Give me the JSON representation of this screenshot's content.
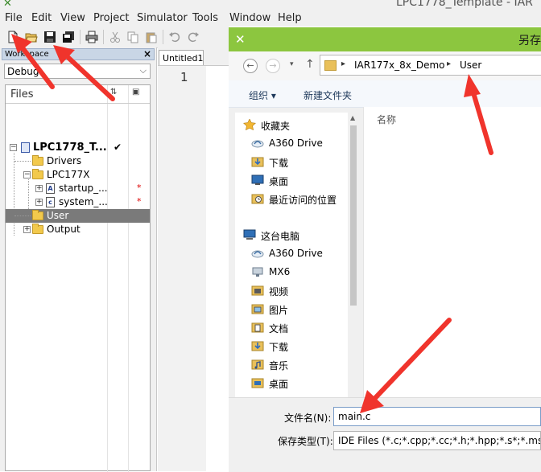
{
  "ide": {
    "title": "LPC1778_Template - IAR",
    "menu": [
      "File",
      "Edit",
      "View",
      "Project",
      "Simulator",
      "Tools",
      "Window",
      "Help"
    ],
    "toolbar_icons": [
      "new-file-icon",
      "open-folder-icon",
      "save-icon",
      "save-all-icon",
      "print-icon",
      "cut-icon",
      "copy-icon",
      "paste-icon",
      "undo-icon",
      "redo-icon"
    ]
  },
  "workspace": {
    "header": "Workspace",
    "close": "×",
    "config": "Debug",
    "files_header": "Files",
    "tree": [
      {
        "label": "LPC1778_T...",
        "check": "✔"
      },
      {
        "label": "Drivers"
      },
      {
        "label": "LPC177X"
      },
      {
        "label": "startup_...",
        "star": "*"
      },
      {
        "label": "system_...",
        "star": "*"
      },
      {
        "label": "User"
      },
      {
        "label": "Output"
      }
    ]
  },
  "editor": {
    "tab": "Untitled1",
    "line": "1"
  },
  "dialog": {
    "title": "另存",
    "path": [
      "IAR177x_8x_Demo",
      "User"
    ],
    "organize": "组织 ▾",
    "new_folder": "新建文件夹",
    "name_col": "名称",
    "favorites": {
      "label": "收藏夹",
      "items": [
        "A360 Drive",
        "下载",
        "桌面",
        "最近访问的位置"
      ]
    },
    "computer": {
      "label": "这台电脑",
      "items": [
        "A360 Drive",
        "MX6",
        "视频",
        "图片",
        "文档",
        "下载",
        "音乐",
        "桌面"
      ]
    },
    "filename_label": "文件名(N):",
    "filename": "main.c",
    "filetype_label": "保存类型(T):",
    "filetype": "IDE Files (*.c;*.cpp;*.cc;*.h;*.hpp;*.s*;*.msa;*.a"
  }
}
